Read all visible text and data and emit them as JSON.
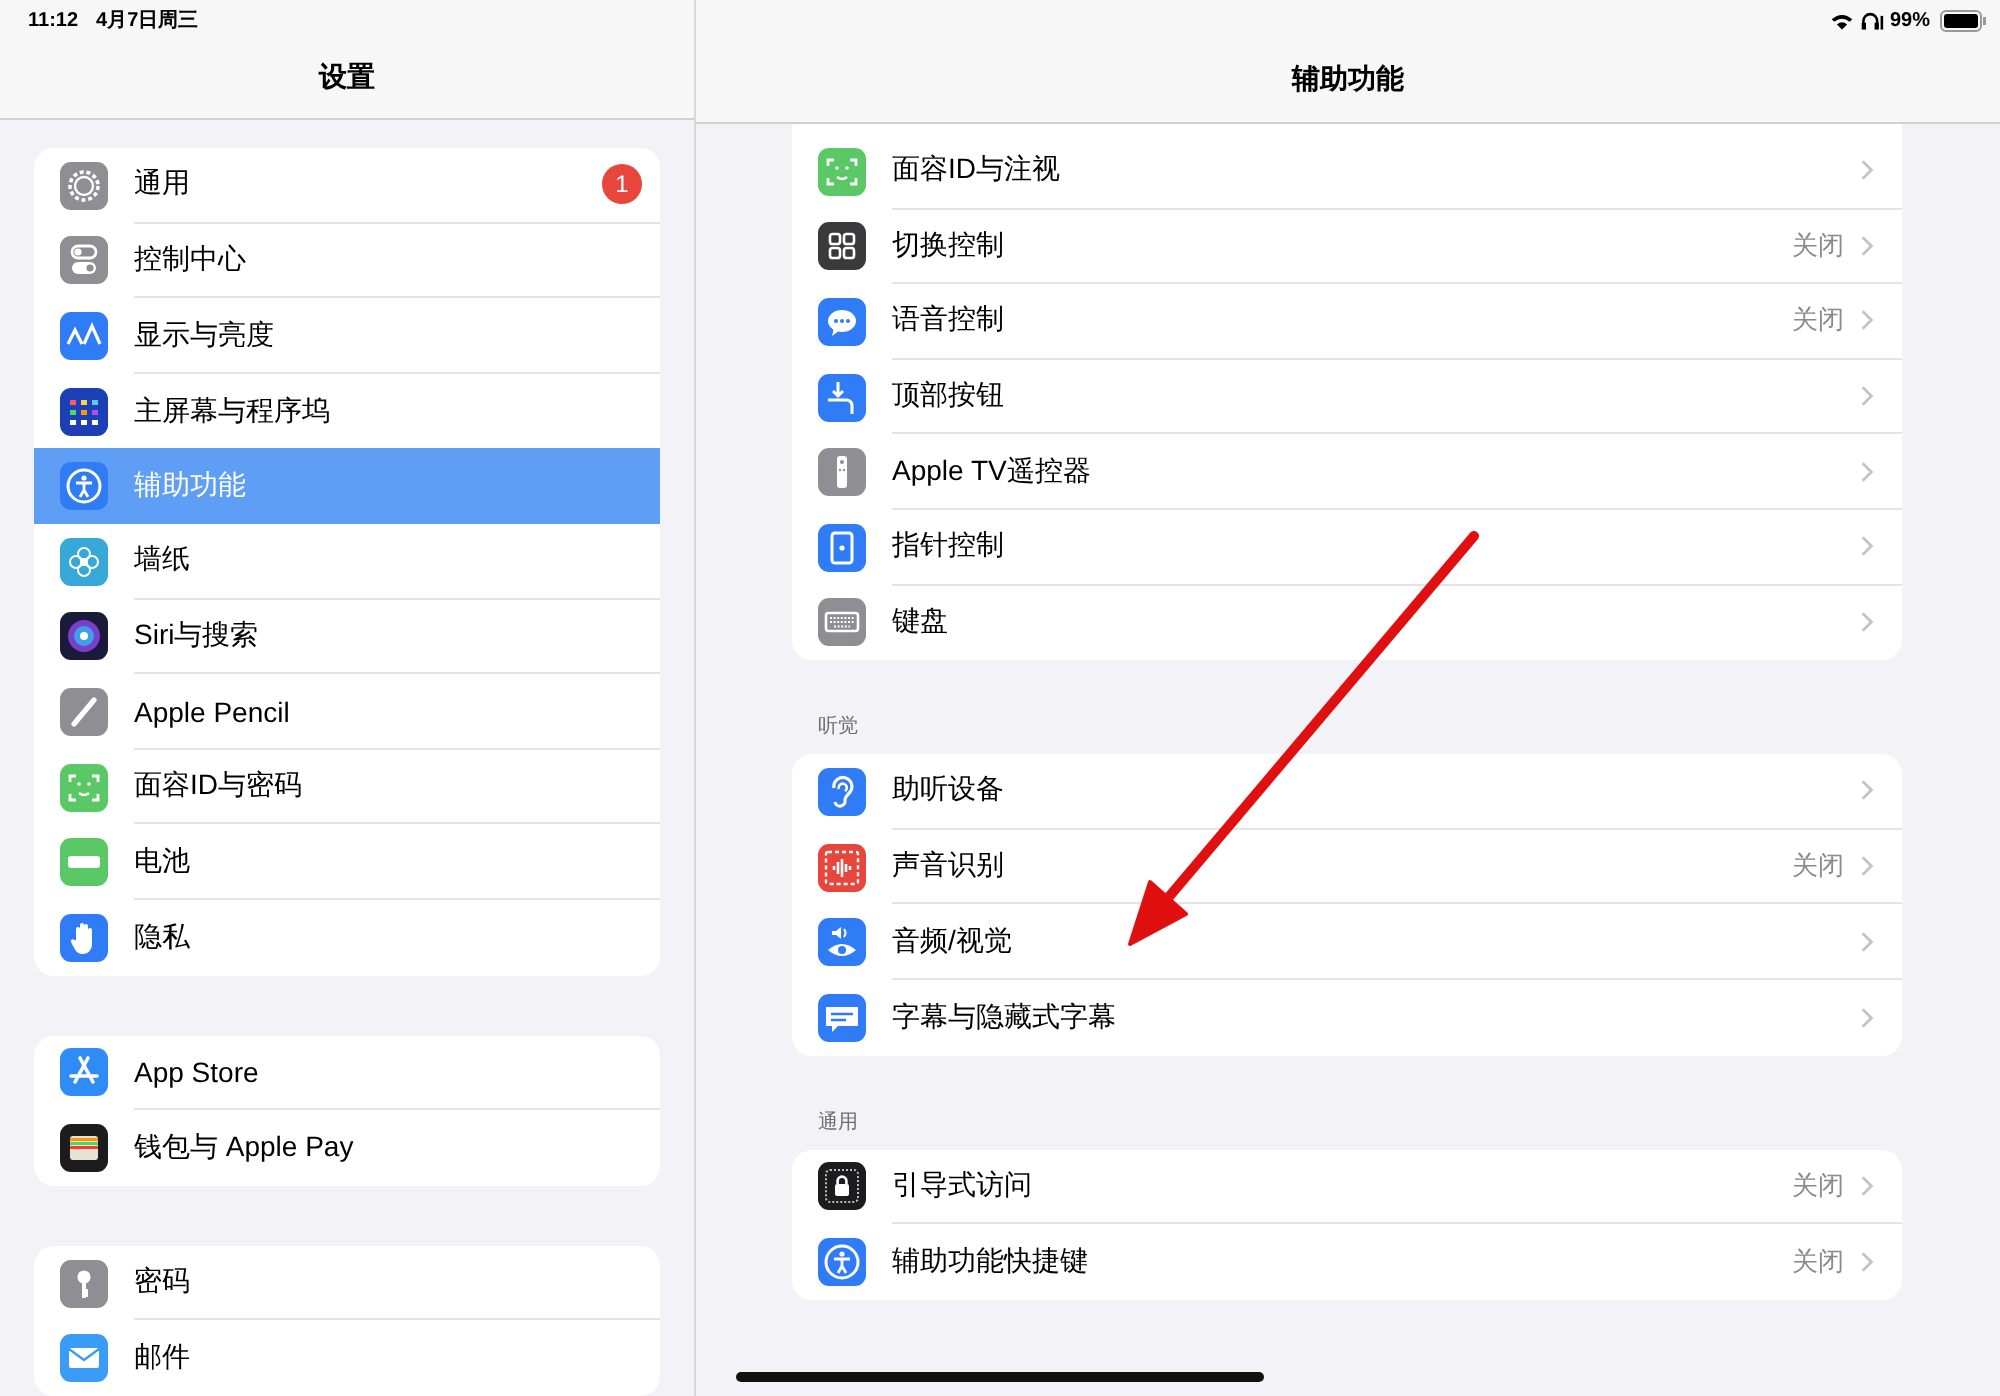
{
  "status_bar": {
    "time": "11:12",
    "date": "4月7日周三",
    "battery": "99%"
  },
  "sidebar": {
    "title": "设置",
    "groups": [
      {
        "items": [
          {
            "label": "通用",
            "badge": "1",
            "selected": false
          },
          {
            "label": "控制中心",
            "selected": false
          },
          {
            "label": "显示与亮度",
            "selected": false
          },
          {
            "label": "主屏幕与程序坞",
            "selected": false
          },
          {
            "label": "辅助功能",
            "selected": true
          },
          {
            "label": "墙纸",
            "selected": false
          },
          {
            "label": "Siri与搜索",
            "selected": false
          },
          {
            "label": "Apple Pencil",
            "selected": false
          },
          {
            "label": "面容ID与密码",
            "selected": false
          },
          {
            "label": "电池",
            "selected": false
          },
          {
            "label": "隐私",
            "selected": false
          }
        ]
      },
      {
        "items": [
          {
            "label": "App Store",
            "selected": false
          },
          {
            "label": "钱包与 Apple Pay",
            "selected": false
          }
        ]
      },
      {
        "items": [
          {
            "label": "密码",
            "selected": false
          },
          {
            "label": "邮件",
            "selected": false
          }
        ]
      }
    ]
  },
  "detail": {
    "title": "辅助功能",
    "sections": [
      {
        "items": [
          {
            "label": "面容ID与注视"
          },
          {
            "label": "切换控制",
            "value": "关闭"
          },
          {
            "label": "语音控制",
            "value": "关闭"
          },
          {
            "label": "顶部按钮"
          },
          {
            "label": "Apple TV遥控器"
          },
          {
            "label": "指针控制"
          },
          {
            "label": "键盘"
          }
        ]
      },
      {
        "header": "听觉",
        "items": [
          {
            "label": "助听设备"
          },
          {
            "label": "声音识别",
            "value": "关闭"
          },
          {
            "label": "音频/视觉"
          },
          {
            "label": "字幕与隐藏式字幕"
          }
        ]
      },
      {
        "header": "通用",
        "items": [
          {
            "label": "引导式访问",
            "value": "关闭"
          },
          {
            "label": "辅助功能快捷键",
            "value": "关闭"
          }
        ]
      }
    ]
  }
}
